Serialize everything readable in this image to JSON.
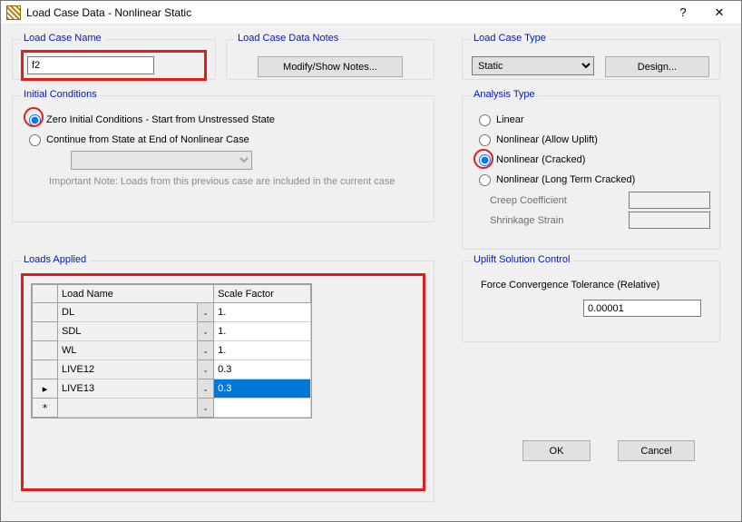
{
  "window": {
    "title": "Load Case Data - Nonlinear Static"
  },
  "loadCaseName": {
    "legend": "Load Case Name",
    "value": "f2"
  },
  "notes": {
    "legend": "Load Case Data Notes",
    "button": "Modify/Show Notes..."
  },
  "loadCaseType": {
    "legend": "Load Case Type",
    "selected": "Static",
    "designButton": "Design..."
  },
  "initialConditions": {
    "legend": "Initial Conditions",
    "zero": "Zero Initial Conditions - Start from Unstressed State",
    "cont": "Continue from State at End of Nonlinear Case",
    "note": "Important Note:  Loads from this previous case are included in the current case"
  },
  "analysisType": {
    "legend": "Analysis Type",
    "options": {
      "linear": "Linear",
      "uplift": "Nonlinear (Allow Uplift)",
      "cracked": "Nonlinear (Cracked)",
      "longterm": "Nonlinear (Long Term Cracked)"
    },
    "creepLabel": "Creep Coefficient",
    "shrinkLabel": "Shrinkage Strain"
  },
  "loadsApplied": {
    "legend": "Loads Applied",
    "headers": {
      "loadName": "Load Name",
      "scaleFactor": "Scale Factor"
    },
    "rows": [
      {
        "name": "DL",
        "sf": "1."
      },
      {
        "name": "SDL",
        "sf": "1."
      },
      {
        "name": "WL",
        "sf": "1."
      },
      {
        "name": "LIVE12",
        "sf": "0.3"
      },
      {
        "name": "LIVE13",
        "sf": "0.3"
      }
    ],
    "rowMarker": "▸",
    "newMarker": "*"
  },
  "uplift": {
    "legend": "Uplift Solution Control",
    "tolLabel": "Force Convergence Tolerance (Relative)",
    "tolValue": "0.00001"
  },
  "buttons": {
    "ok": "OK",
    "cancel": "Cancel"
  }
}
